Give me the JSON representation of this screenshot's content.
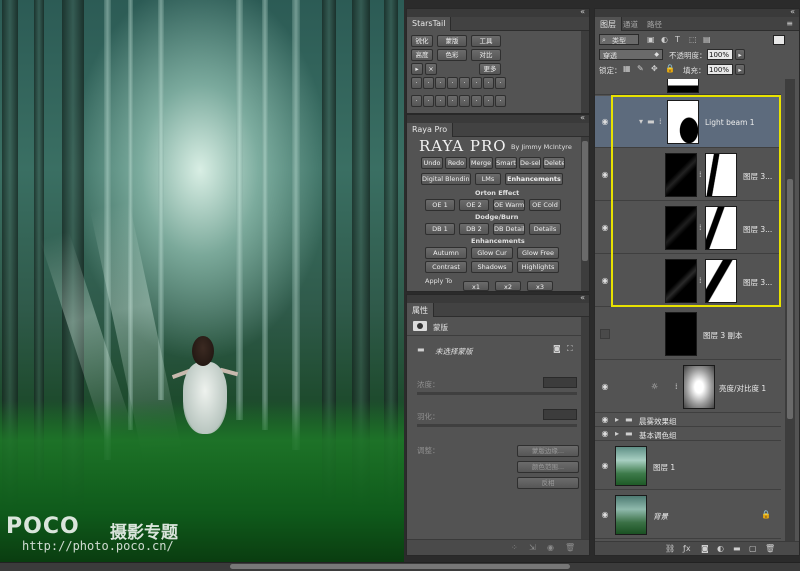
{
  "watermark": {
    "logo": "POCO",
    "title": "摄影专题",
    "url": "http://photo.poco.cn/"
  },
  "starstail": {
    "tab": "StarsTail",
    "row1": [
      "锐化",
      "蒙版",
      "工具"
    ],
    "row2": [
      "高度",
      "色彩",
      "对比"
    ],
    "more": "更多"
  },
  "raya": {
    "tab": "Raya Pro",
    "logo": "RAYA PRO",
    "byline": "By Jimmy McIntyre",
    "row1": [
      "Undo",
      "Redo",
      "Merge",
      "Smart",
      "De-sel",
      "Delete"
    ],
    "subtabs": [
      "Digital Blending",
      "LMs",
      "Enhancements"
    ],
    "orton_heading": "Orton Effect",
    "orton": [
      "OE 1",
      "OE 2",
      "OE Warm",
      "OE Cold"
    ],
    "dodge_heading": "Dodge/Burn",
    "dodge": [
      "DB 1",
      "DB 2",
      "DB Details",
      "Details"
    ],
    "enh_heading": "Enhancements",
    "enh1": [
      "Autumn",
      "Glow Cur",
      "Glow Free"
    ],
    "enh2": [
      "Contrast",
      "Shadows",
      "Highlights"
    ],
    "apply_to": "Apply To",
    "apply_opts": [
      "x1",
      "x2",
      "x3"
    ]
  },
  "properties": {
    "tab": "属性",
    "type_label": "蒙版",
    "mask_name": "未选择蒙版",
    "density_label": "浓度：",
    "feather_label": "羽化：",
    "adjust_label": "调整：",
    "btn_edge": "蒙版边缘...",
    "btn_color": "颜色范围...",
    "btn_invert": "反相"
  },
  "layers": {
    "tabs": [
      "图层",
      "通道",
      "路径"
    ],
    "kind_filter": "类型",
    "blend_mode": "穿透",
    "opacity_label": "不透明度：",
    "opacity_value": "100%",
    "lock_label": "锁定：",
    "fill_label": "填充：",
    "fill_value": "100%",
    "rows": [
      {
        "name": "Light beam 1",
        "kind": "group"
      },
      {
        "name": "图层 3...",
        "kind": "layer"
      },
      {
        "name": "图层 3...",
        "kind": "layer"
      },
      {
        "name": "图层 3...",
        "kind": "layer"
      },
      {
        "name": "图层 3 副本",
        "kind": "layer"
      },
      {
        "name": "亮度/对比度 1",
        "kind": "adjustment"
      },
      {
        "name": "晨雾效果组",
        "kind": "group"
      },
      {
        "name": "基本调色组",
        "kind": "group"
      },
      {
        "name": "图层 1",
        "kind": "layer"
      },
      {
        "name": "背景",
        "kind": "background"
      }
    ]
  },
  "colors": {
    "panel": "#535353",
    "highlight": "#e8e200",
    "selected_row": "#5d6b7d"
  }
}
